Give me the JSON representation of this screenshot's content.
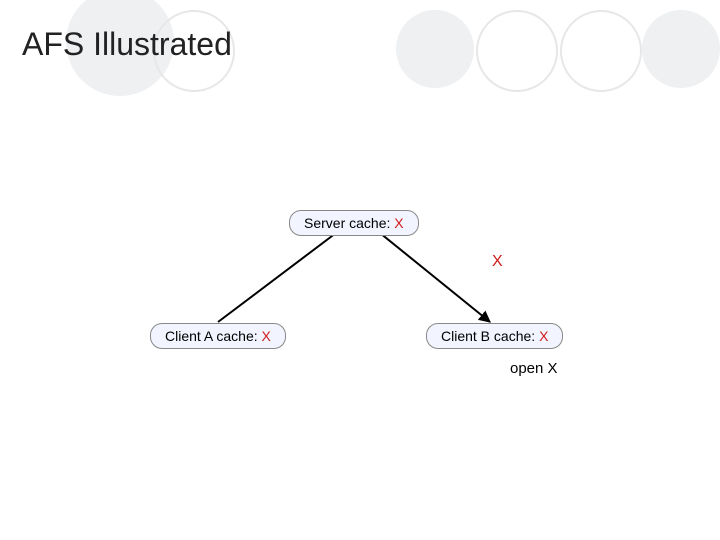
{
  "title": "AFS Illustrated",
  "server": {
    "label_prefix": "Server cache: ",
    "value": "X"
  },
  "clientA": {
    "label_prefix": "Client A cache: ",
    "value": "X"
  },
  "clientB": {
    "label_prefix": "Client B cache: ",
    "value": "X"
  },
  "edge_label": "X",
  "action_label": "open X"
}
